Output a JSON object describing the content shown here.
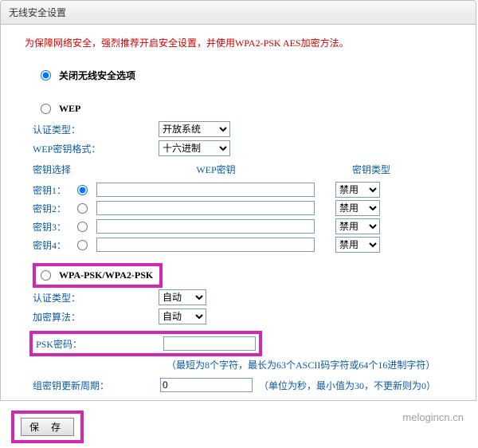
{
  "header": {
    "title": "无线安全设置"
  },
  "notice": "为保障网络安全，强烈推荐开启安全设置，并使用WPA2-PSK AES加密方法。",
  "sections": {
    "disable": {
      "label": "关闭无线安全选项"
    },
    "wep": {
      "label": "WEP",
      "authLabel": "认证类型：",
      "authSelected": "开放系统",
      "formatLabel": "WEP密钥格式：",
      "formatSelected": "十六进制",
      "keySelectLabel": "密钥选择",
      "keyColHeader": "WEP密钥",
      "typeColHeader": "密钥类型",
      "rows": [
        {
          "label": "密钥1：",
          "value": "",
          "type": "禁用"
        },
        {
          "label": "密钥2：",
          "value": "",
          "type": "禁用"
        },
        {
          "label": "密钥3：",
          "value": "",
          "type": "禁用"
        },
        {
          "label": "密钥4：",
          "value": "",
          "type": "禁用"
        }
      ]
    },
    "wpa": {
      "label": "WPA-PSK/WPA2-PSK",
      "authLabel": "认证类型：",
      "authSelected": "自动",
      "algoLabel": "加密算法：",
      "algoSelected": "自动",
      "pskLabel": "PSK密码：",
      "pskValue": "",
      "pskHint": "（最短为8个字符，最长为63个ASCII码字符或64个16进制字符）",
      "groupLabel": "组密钥更新周期：",
      "groupValue": "0",
      "groupUnit": "（单位为秒，最小值为30，不更新则为0）"
    }
  },
  "save": {
    "label": "保 存"
  },
  "watermark": "melogincn.cn"
}
